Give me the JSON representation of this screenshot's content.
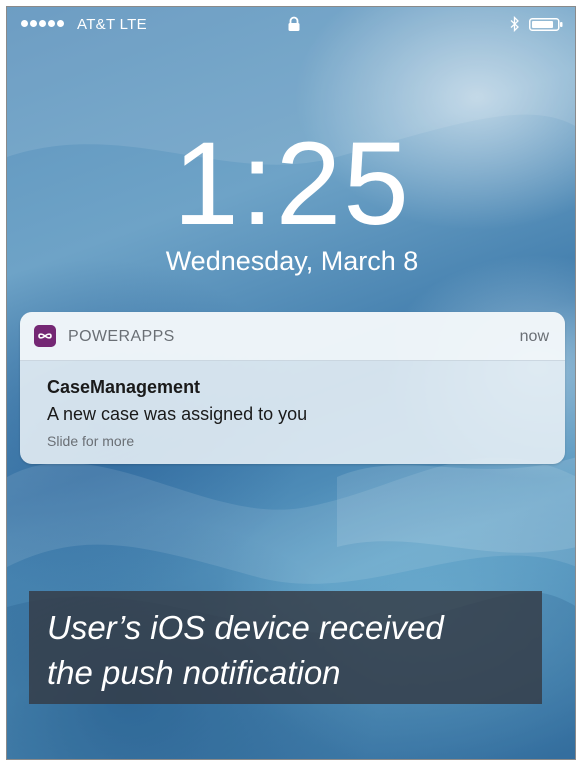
{
  "status_bar": {
    "carrier": "AT&T  LTE",
    "signal_icon": "signal-dots-icon",
    "lock_icon": "lock-icon",
    "bluetooth_icon": "bluetooth-icon",
    "battery_icon": "battery-icon"
  },
  "lock_screen": {
    "time": "1:25",
    "date": "Wednesday, March 8"
  },
  "notification": {
    "app_name": "POWERAPPS",
    "time": "now",
    "title": "CaseManagement",
    "body": "A new case was assigned to you",
    "hint": "Slide for more",
    "app_icon": "powerapps-icon",
    "app_icon_color": "#742774"
  },
  "caption": {
    "line1": "User’s iOS device received",
    "line2": "the push notification"
  }
}
